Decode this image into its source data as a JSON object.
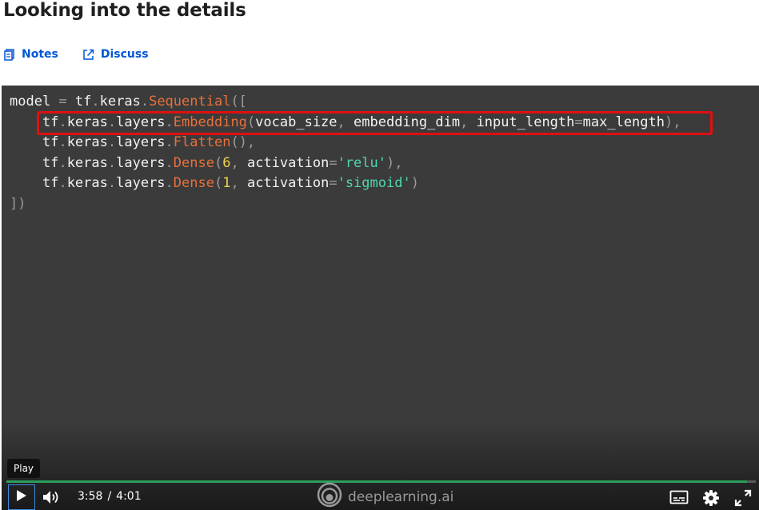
{
  "page": {
    "title": "Looking into the details"
  },
  "links": {
    "notes": "Notes",
    "discuss": "Discuss"
  },
  "code": {
    "l1_a": "model",
    "l1_b": " = ",
    "l1_c": "tf",
    "l1_d": ".",
    "l1_e": "keras",
    "l1_f": ".",
    "l1_g": "Sequential",
    "l1_h": "([",
    "l2_a": "tf",
    "l2_b": ".",
    "l2_c": "keras",
    "l2_d": ".",
    "l2_e": "layers",
    "l2_f": ".",
    "l2_g": "Embedding",
    "l2_h": "(",
    "l2_i": "vocab_size",
    "l2_j": ", ",
    "l2_k": "embedding_dim",
    "l2_l": ", ",
    "l2_m": "input_length",
    "l2_n": "=",
    "l2_o": "max_length",
    "l2_p": "),",
    "l3_a": "tf",
    "l3_b": ".",
    "l3_c": "keras",
    "l3_d": ".",
    "l3_e": "layers",
    "l3_f": ".",
    "l3_g": "Flatten",
    "l3_h": "(),",
    "l4_a": "tf",
    "l4_b": ".",
    "l4_c": "keras",
    "l4_d": ".",
    "l4_e": "layers",
    "l4_f": ".",
    "l4_g": "Dense",
    "l4_h": "(",
    "l4_i": "6",
    "l4_j": ", ",
    "l4_k": "activation",
    "l4_l": "=",
    "l4_m": "'relu'",
    "l4_n": "),",
    "l5_a": "tf",
    "l5_b": ".",
    "l5_c": "keras",
    "l5_d": ".",
    "l5_e": "layers",
    "l5_f": ".",
    "l5_g": "Dense",
    "l5_h": "(",
    "l5_i": "1",
    "l5_j": ", ",
    "l5_k": "activation",
    "l5_l": "=",
    "l5_m": "'sigmoid'",
    "l5_n": ")",
    "l6": "])"
  },
  "player": {
    "tooltip": "Play",
    "current_time": "3:58",
    "separator": "/",
    "duration": "4:01",
    "progress_fraction": 0.988,
    "logo_text": "deeplearning.ai",
    "accent_color": "#2ba05c",
    "highlight_color": "#e01010",
    "icons": [
      "play-icon",
      "volume-icon",
      "captions-icon",
      "settings-gear-icon",
      "fullscreen-icon",
      "deeplearning-logo-icon"
    ]
  }
}
